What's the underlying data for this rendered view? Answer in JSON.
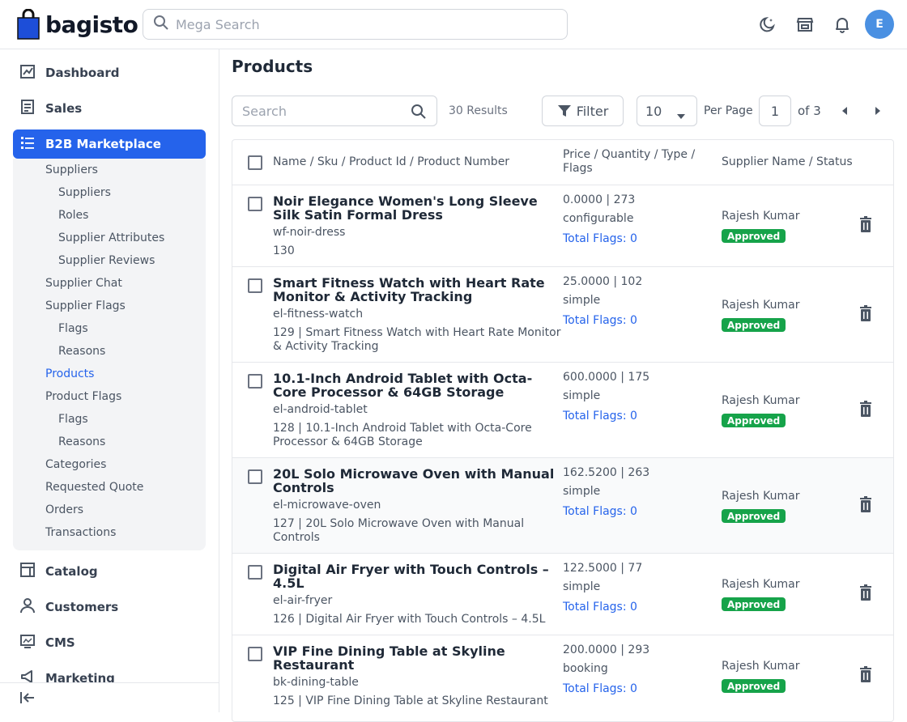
{
  "brand": {
    "name": "bagisto"
  },
  "header": {
    "search_placeholder": "Mega Search",
    "avatar_initial": "E"
  },
  "sidebar": {
    "items": [
      {
        "label": "Dashboard",
        "icon": "dashboard-icon"
      },
      {
        "label": "Sales",
        "icon": "sales-icon"
      },
      {
        "label": "B2B Marketplace",
        "icon": "list-icon",
        "active": true
      },
      {
        "label": "Catalog",
        "icon": "catalog-icon"
      },
      {
        "label": "Customers",
        "icon": "customers-icon"
      },
      {
        "label": "CMS",
        "icon": "cms-icon"
      },
      {
        "label": "Marketing",
        "icon": "marketing-icon"
      }
    ],
    "sub": [
      {
        "label": "Suppliers",
        "level": 1
      },
      {
        "label": "Suppliers",
        "level": 2
      },
      {
        "label": "Roles",
        "level": 2
      },
      {
        "label": "Supplier Attributes",
        "level": 2
      },
      {
        "label": "Supplier Reviews",
        "level": 2
      },
      {
        "label": "Supplier Chat",
        "level": 1
      },
      {
        "label": "Supplier Flags",
        "level": 1
      },
      {
        "label": "Flags",
        "level": 2
      },
      {
        "label": "Reasons",
        "level": 2
      },
      {
        "label": "Products",
        "level": 1,
        "active": true
      },
      {
        "label": "Product Flags",
        "level": 1
      },
      {
        "label": "Flags",
        "level": 2
      },
      {
        "label": "Reasons",
        "level": 2
      },
      {
        "label": "Categories",
        "level": 1
      },
      {
        "label": "Requested Quote",
        "level": 1
      },
      {
        "label": "Orders",
        "level": 1
      },
      {
        "label": "Transactions",
        "level": 1
      }
    ]
  },
  "page": {
    "title": "Products"
  },
  "toolbar": {
    "search_placeholder": "Search",
    "results": "30 Results",
    "filter_label": "Filter",
    "per_page_value": "10",
    "per_page_label": "Per Page",
    "page_value": "1",
    "of_label": "of 3"
  },
  "table": {
    "headers": {
      "col1": "Name / Sku / Product Id / Product Number",
      "col2_line1": "Price / Quantity / Type /",
      "col2_line2": "Flags",
      "col3": "Supplier Name / Status"
    },
    "rows": [
      {
        "name": "Noir Elegance Women's Long Sleeve Silk Satin Formal Dress",
        "sku": "wf-noir-dress",
        "number": "130",
        "price": "0.0000 | 273",
        "type": "configurable",
        "flags": "Total Flags: 0",
        "supplier": "Rajesh Kumar",
        "status": "Approved"
      },
      {
        "name": "Smart Fitness Watch with Heart Rate Monitor & Activity Tracking",
        "sku": "el-fitness-watch",
        "number": "129 | Smart Fitness Watch with Heart Rate Monitor & Activity Tracking",
        "price": "25.0000 | 102",
        "type": "simple",
        "flags": "Total Flags: 0",
        "supplier": "Rajesh Kumar",
        "status": "Approved"
      },
      {
        "name": "10.1-Inch Android Tablet with Octa-Core Processor & 64GB Storage",
        "sku": "el-android-tablet",
        "number": "128 | 10.1-Inch Android Tablet with Octa-Core Processor & 64GB Storage",
        "price": "600.0000 | 175",
        "type": "simple",
        "flags": "Total Flags: 0",
        "supplier": "Rajesh Kumar",
        "status": "Approved"
      },
      {
        "name": "20L Solo Microwave Oven with Manual Controls",
        "sku": "el-microwave-oven",
        "number": "127 | 20L Solo Microwave Oven with Manual Controls",
        "price": "162.5200 | 263",
        "type": "simple",
        "flags": "Total Flags: 0",
        "supplier": "Rajesh Kumar",
        "status": "Approved"
      },
      {
        "name": "Digital Air Fryer with Touch Controls – 4.5L",
        "sku": "el-air-fryer",
        "number": "126 | Digital Air Fryer with Touch Controls – 4.5L",
        "price": "122.5000 | 77",
        "type": "simple",
        "flags": "Total Flags: 0",
        "supplier": "Rajesh Kumar",
        "status": "Approved"
      },
      {
        "name": "VIP Fine Dining Table at Skyline Restaurant",
        "sku": "bk-dining-table",
        "number": "125 | VIP Fine Dining Table at Skyline Restaurant",
        "price": "200.0000 | 293",
        "type": "booking",
        "flags": "Total Flags: 0",
        "supplier": "Rajesh Kumar",
        "status": "Approved"
      }
    ]
  }
}
